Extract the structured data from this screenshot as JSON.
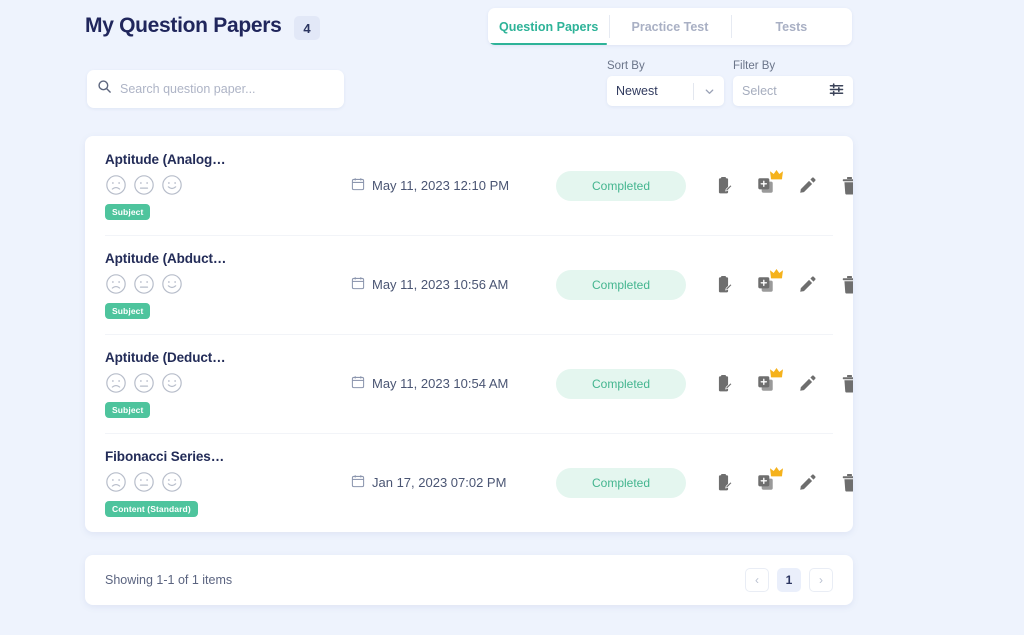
{
  "header": {
    "title": "My Question Papers",
    "count": "4"
  },
  "tabs": [
    {
      "label": "Question Papers",
      "active": true
    },
    {
      "label": "Practice Test",
      "active": false
    },
    {
      "label": "Tests",
      "active": false
    }
  ],
  "search": {
    "placeholder": "Search question paper...",
    "value": "",
    "icon": "search-icon"
  },
  "sort": {
    "label": "Sort By",
    "value": "Newest",
    "icon": "chevron-down-icon",
    "options": [
      "Newest"
    ]
  },
  "filter": {
    "label": "Filter By",
    "value": "Select",
    "icon": "filter-sliders-icon",
    "options": [
      "Select"
    ]
  },
  "rows": [
    {
      "title": "Aptitude (Analog…",
      "date": "May 11, 2023 12:10 PM",
      "status": "Completed",
      "badge": "Subject",
      "ratings": [
        "sad-face-icon",
        "neutral-face-icon",
        "happy-face-icon"
      ]
    },
    {
      "title": "Aptitude (Abduct…",
      "date": "May 11, 2023 10:56 AM",
      "status": "Completed",
      "badge": "Subject",
      "ratings": [
        "sad-face-icon",
        "neutral-face-icon",
        "happy-face-icon"
      ]
    },
    {
      "title": "Aptitude (Deduct…",
      "date": "May 11, 2023 10:54 AM",
      "status": "Completed",
      "badge": "Subject",
      "ratings": [
        "sad-face-icon",
        "neutral-face-icon",
        "happy-face-icon"
      ]
    },
    {
      "title": "Fibonacci Series…",
      "date": "Jan 17, 2023 07:02 PM",
      "status": "Completed",
      "badge": "Content (Standard)",
      "ratings": [
        "sad-face-icon",
        "neutral-face-icon",
        "happy-face-icon"
      ]
    }
  ],
  "row_actions": [
    "clipboard-edit-icon",
    "duplicate-add-premium-icon",
    "edit-pencil-icon",
    "delete-trash-icon",
    "download-icon",
    "share-icon"
  ],
  "footer": {
    "showing": "Showing 1-1 of 1 items",
    "prev": "‹",
    "page": "1",
    "next": "›"
  },
  "colors": {
    "page_bg": "#eef3fd",
    "accent_green": "#2eb398",
    "badge_green": "#4ec49d",
    "status_bg": "#e4f6ef",
    "status_text": "#44b58f",
    "title_navy": "#20265c",
    "crown_gold": "#f5b21c"
  }
}
